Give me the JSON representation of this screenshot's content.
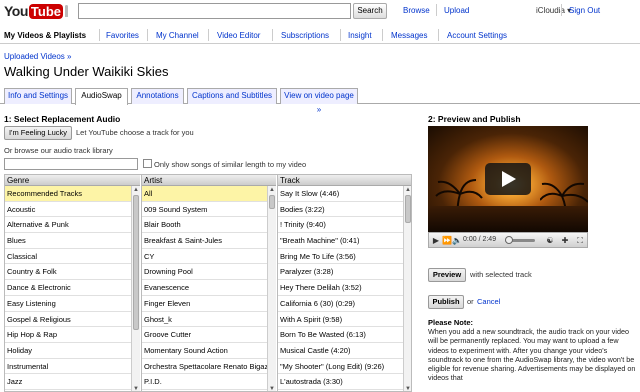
{
  "header": {
    "logo_you": "You",
    "logo_tube": "Tube",
    "search_button": "Search",
    "links": [
      "Browse",
      "Upload"
    ],
    "username": "iCloudia",
    "sign_out": "Sign Out"
  },
  "nav": {
    "items": [
      "My Videos & Playlists",
      "Favorites",
      "My Channel",
      "Video Editor",
      "Subscriptions",
      "Insight",
      "Messages",
      "Account Settings"
    ]
  },
  "breadcrumb": "Uploaded Videos »",
  "page_title": "Walking Under Waikiki Skies",
  "tabs": [
    "Info and Settings",
    "AudioSwap",
    "Annotations",
    "Captions and Subtitles",
    "View on video page »"
  ],
  "left": {
    "section_title": "1: Select Replacement Audio",
    "lucky_button": "I'm Feeling Lucky",
    "lucky_desc": "Let YouTube choose a track for you",
    "browse_text": "Or browse our audio track library",
    "similar_label": "Only show songs of similar length to my video"
  },
  "library": {
    "headers": {
      "genre": "Genre",
      "artist": "Artist",
      "track": "Track"
    },
    "genres": [
      "Recommended Tracks",
      "Acoustic",
      "Alternative & Punk",
      "Blues",
      "Classical",
      "Country & Folk",
      "Dance & Electronic",
      "Easy Listening",
      "Gospel & Religious",
      "Hip Hop & Rap",
      "Holiday",
      "Instrumental",
      "Jazz",
      "Metal"
    ],
    "artists": [
      "All",
      "009 Sound System",
      "Blair Booth",
      "Breakfast & Saint-Jules",
      "CY",
      "Drowning Pool",
      "Evanescence",
      "Finger Eleven",
      "Ghost_k",
      "Groove Cutter",
      "Momentary Sound Action",
      "Orchestra Spettacolare Renato Bigazzi",
      "P.I.D."
    ],
    "tracks": [
      "Say It Slow (4:46)",
      "Bodies (3:22)",
      "! Trinity (9:40)",
      "\"Breath Machine\" (0:41)",
      "Bring Me To Life (3:56)",
      "Paralyzer (3:28)",
      "Hey There Delilah (3:52)",
      "California 6 (30) (0:29)",
      "With A Spirit (9:58)",
      "Born To Be Wasted (6:13)",
      "Musical Castle (4:20)",
      "\"My Shooter\" (Long Edit) (9:26)",
      "L'autostrada (3:30)",
      "Only Two Should Know (Campfire"
    ]
  },
  "right": {
    "section_title": "2: Preview and Publish",
    "time": "0:00 / 2:49",
    "preview_button": "Preview",
    "preview_desc": "with selected track",
    "publish_button": "Publish",
    "or_text": "or",
    "cancel_link": "Cancel",
    "note_title": "Please Note:",
    "note_text": "When you add a new soundtrack, the audio track on your video will be permanently replaced. You may want to upload a few videos to experiment with. After you change your video's soundtrack to one from the AudioSwap library, the video won't be eligible for revenue sharing. Advertisements may be displayed on videos that"
  }
}
